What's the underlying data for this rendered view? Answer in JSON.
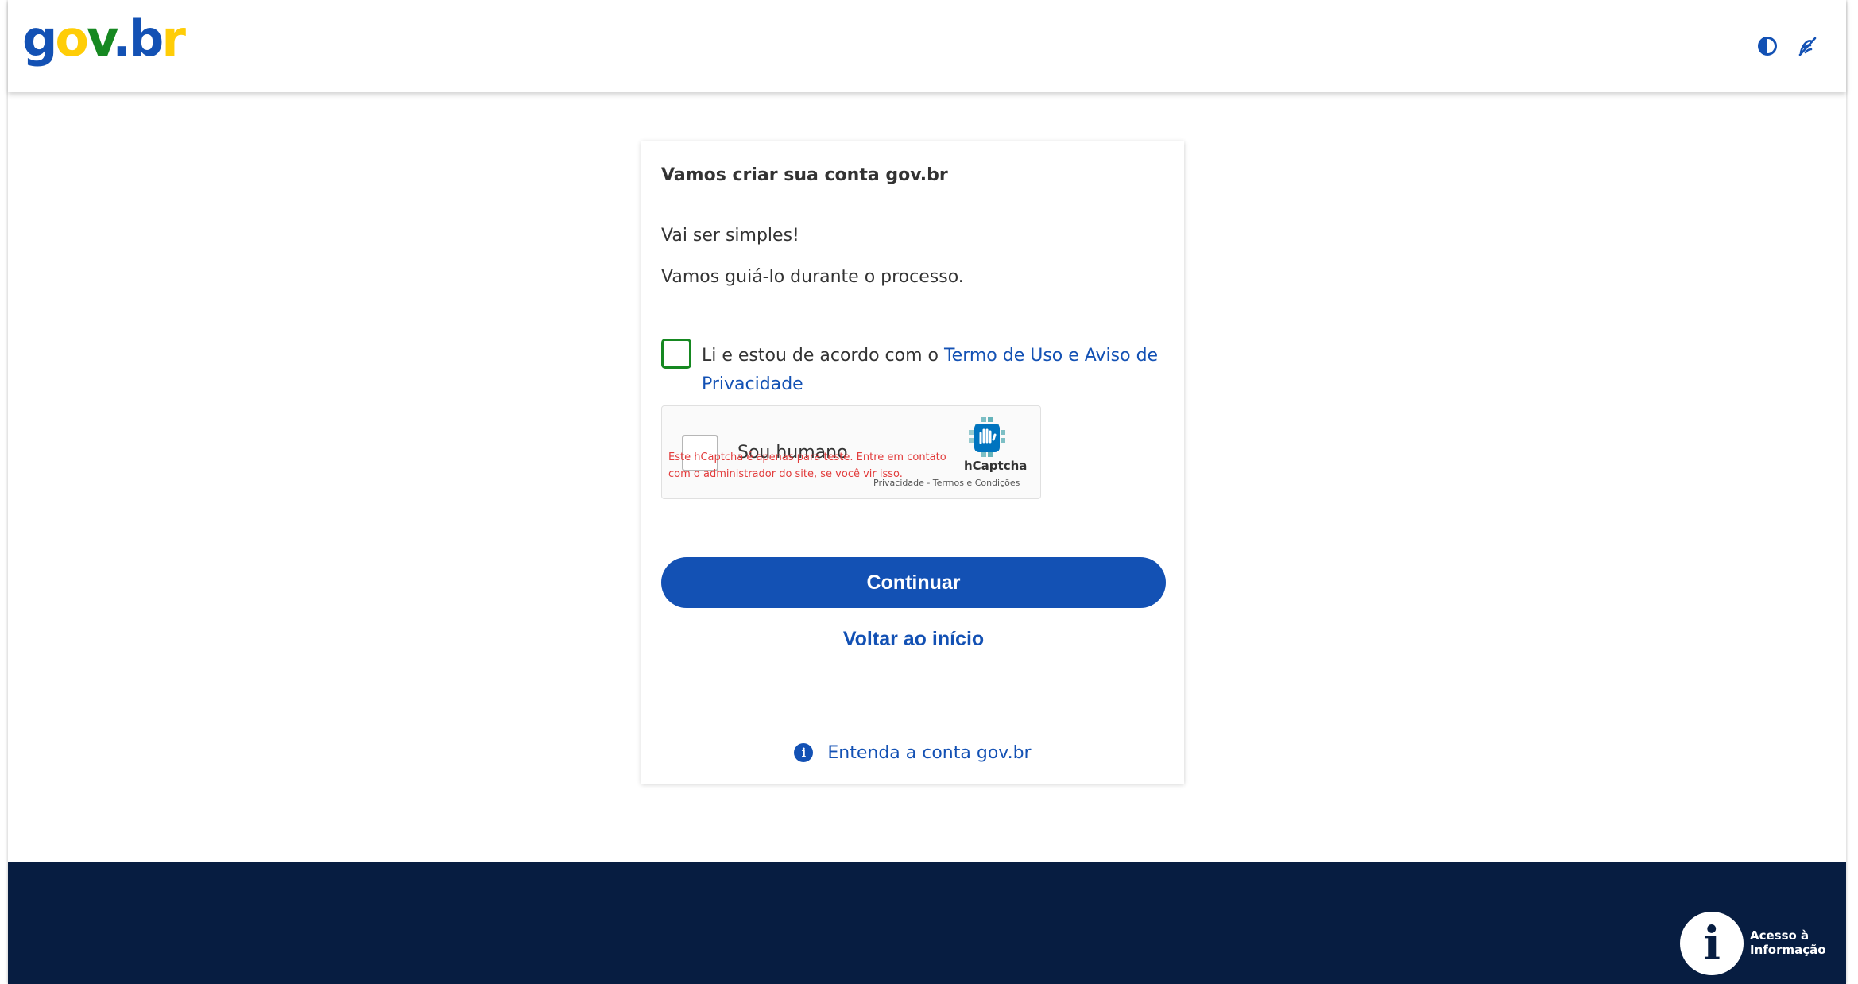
{
  "header": {
    "logo": {
      "g": "g",
      "o": "o",
      "v": "v",
      "dot": ".",
      "b": "b",
      "r": "r"
    },
    "icons": {
      "contrast": "contrast-icon",
      "accessibility": "sign-language-icon"
    }
  },
  "card": {
    "title": "Vamos criar sua conta gov.br",
    "text1": "Vai ser simples!",
    "text2": "Vamos guiá-lo durante o processo.",
    "terms_prefix": "Li e estou de acordo com o ",
    "terms_link": "Termo de Uso e Aviso de Privacidade",
    "captcha": {
      "label": "Sou humano",
      "error": "Este hCaptcha é apenas para teste. Entre em contato com o administrador do site, se você vir isso.",
      "brand": "hCaptcha",
      "links": "Privacidade - Termos e Condições"
    },
    "continue_label": "Continuar",
    "back_label": "Voltar ao início",
    "understand_label": "Entenda a conta gov.br",
    "info_icon_glyph": "i"
  },
  "footer": {
    "access_info": "Acesso à Informação",
    "access_icon_glyph": "i"
  },
  "colors": {
    "primary": "#1351b4",
    "green": "#168821",
    "yellow": "#ffcd07",
    "footer_bg": "#071d41",
    "error": "#e23b3b"
  }
}
